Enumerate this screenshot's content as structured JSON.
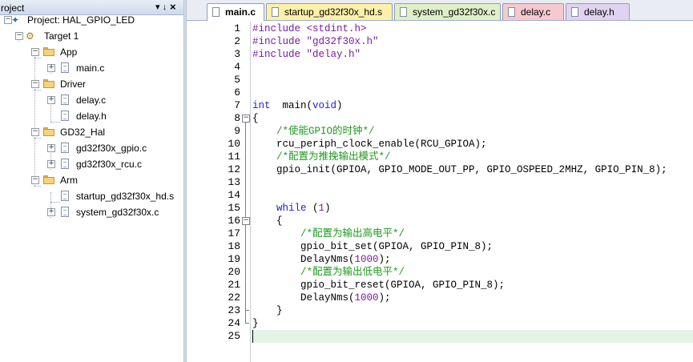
{
  "panel": {
    "title": "roject",
    "pin_glyph": "▾ ↓",
    "close_glyph": "×"
  },
  "tree": [
    {
      "id": "project",
      "label": "Project: HAL_GPIO_LED",
      "icon": "project-icon",
      "toggle": "−"
    },
    {
      "id": "target",
      "label": "Target 1",
      "icon": "target-icon",
      "toggle": "−"
    },
    {
      "id": "group-app",
      "label": "App",
      "icon": "folder-icon",
      "toggle": "−"
    },
    {
      "id": "file-main-c",
      "label": "main.c",
      "icon": "file-icon",
      "toggle": "+"
    },
    {
      "id": "group-driver",
      "label": "Driver",
      "icon": "folder-icon",
      "toggle": "−"
    },
    {
      "id": "file-delay-c",
      "label": "delay.c",
      "icon": "file-icon",
      "toggle": "+"
    },
    {
      "id": "file-delay-h",
      "label": "delay.h",
      "icon": "file-icon",
      "toggle": ""
    },
    {
      "id": "group-gd32-hal",
      "label": "GD32_Hal",
      "icon": "folder-icon",
      "toggle": "−"
    },
    {
      "id": "file-gd32f30x-gpio-c",
      "label": "gd32f30x_gpio.c",
      "icon": "file-icon",
      "toggle": "+"
    },
    {
      "id": "file-gd32f30x-rcu-c",
      "label": "gd32f30x_rcu.c",
      "icon": "file-icon",
      "toggle": "+"
    },
    {
      "id": "group-arm",
      "label": "Arm",
      "icon": "folder-icon",
      "toggle": "−"
    },
    {
      "id": "file-startup-s",
      "label": "startup_gd32f30x_hd.s",
      "icon": "file-icon",
      "toggle": ""
    },
    {
      "id": "file-system-c",
      "label": "system_gd32f30x.c",
      "icon": "file-icon",
      "toggle": "+"
    }
  ],
  "tabs": [
    {
      "label": "main.c",
      "active": true,
      "color": "#ffffff",
      "icon_color": "#ffffff"
    },
    {
      "label": "startup_gd32f30x_hd.s",
      "active": false,
      "color": "#fdf0a8",
      "icon_color": "#ffffff"
    },
    {
      "label": "system_gd32f30x.c",
      "active": false,
      "color": "#dff0c8",
      "icon_color": "#ffffff"
    },
    {
      "label": "delay.c",
      "active": false,
      "color": "#f6c9cf",
      "icon_color": "#ffffff"
    },
    {
      "label": "delay.h",
      "active": false,
      "color": "#e1d3ef",
      "icon_color": "#ffffff"
    }
  ],
  "colors": {
    "keyword": "#1c1ccc",
    "preprocessor": "#7a1aa0",
    "comment": "#1f9a1f",
    "current_line": "#e2f5e5"
  },
  "code": {
    "current_line": 25,
    "lines": [
      {
        "n": "1",
        "toks": [
          [
            "pp",
            "#include "
          ],
          [
            "str",
            "<stdint.h>"
          ]
        ]
      },
      {
        "n": "2",
        "toks": [
          [
            "pp",
            "#include "
          ],
          [
            "str",
            "\"gd32f30x.h\""
          ]
        ]
      },
      {
        "n": "3",
        "toks": [
          [
            "pp",
            "#include "
          ],
          [
            "str",
            "\"delay.h\""
          ]
        ]
      },
      {
        "n": "4",
        "toks": []
      },
      {
        "n": "5",
        "toks": []
      },
      {
        "n": "6",
        "toks": []
      },
      {
        "n": "7",
        "toks": [
          [
            "kw",
            "int"
          ],
          [
            "",
            "  main("
          ],
          [
            "kw",
            "void"
          ],
          [
            "",
            ")"
          ]
        ]
      },
      {
        "n": "8",
        "toks": [
          [
            "",
            "{"
          ]
        ]
      },
      {
        "n": "9",
        "toks": [
          [
            "",
            "    "
          ],
          [
            "cm",
            "/*使能GPIO的时钟*/"
          ]
        ]
      },
      {
        "n": "10",
        "toks": [
          [
            "",
            "    rcu_periph_clock_enable(RCU_GPIOA);"
          ]
        ]
      },
      {
        "n": "11",
        "toks": [
          [
            "",
            "    "
          ],
          [
            "cm",
            "/*配置为推挽输出模式*/"
          ]
        ]
      },
      {
        "n": "12",
        "toks": [
          [
            "",
            "    gpio_init(GPIOA, GPIO_MODE_OUT_PP, GPIO_OSPEED_2MHZ, GPIO_PIN_8);"
          ]
        ]
      },
      {
        "n": "13",
        "toks": []
      },
      {
        "n": "14",
        "toks": []
      },
      {
        "n": "15",
        "toks": [
          [
            "",
            "    "
          ],
          [
            "kw",
            "while"
          ],
          [
            "",
            " ("
          ],
          [
            "num",
            "1"
          ],
          [
            "",
            ")"
          ]
        ]
      },
      {
        "n": "16",
        "toks": [
          [
            "",
            "    {"
          ]
        ]
      },
      {
        "n": "17",
        "toks": [
          [
            "",
            "        "
          ],
          [
            "cm",
            "/*配置为输出高电平*/"
          ]
        ]
      },
      {
        "n": "18",
        "toks": [
          [
            "",
            "        gpio_bit_set(GPIOA, GPIO_PIN_8);"
          ]
        ]
      },
      {
        "n": "19",
        "toks": [
          [
            "",
            "        DelayNms("
          ],
          [
            "num",
            "1000"
          ],
          [
            "",
            ");"
          ]
        ]
      },
      {
        "n": "20",
        "toks": [
          [
            "",
            "        "
          ],
          [
            "cm",
            "/*配置为输出低电平*/"
          ]
        ]
      },
      {
        "n": "21",
        "toks": [
          [
            "",
            "        gpio_bit_reset(GPIOA, GPIO_PIN_8);"
          ]
        ]
      },
      {
        "n": "22",
        "toks": [
          [
            "",
            "        DelayNms("
          ],
          [
            "num",
            "1000"
          ],
          [
            "",
            ");"
          ]
        ]
      },
      {
        "n": "23",
        "toks": [
          [
            "",
            "    }"
          ]
        ]
      },
      {
        "n": "24",
        "toks": [
          [
            "",
            "}"
          ]
        ]
      },
      {
        "n": "25",
        "toks": []
      }
    ]
  }
}
